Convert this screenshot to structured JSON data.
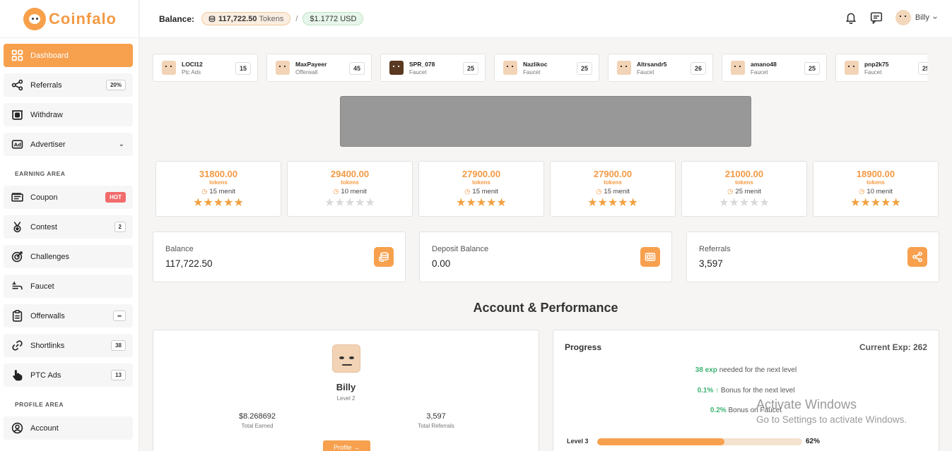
{
  "brand": {
    "name": "Coinfalo"
  },
  "topbar": {
    "balance_label": "Balance:",
    "tokens_value": "117,722.50",
    "tokens_unit": "Tokens",
    "separator": "/",
    "usd_value": "$1.1772 USD",
    "user_name": "Billy"
  },
  "sidebar": {
    "items": [
      {
        "label": "Dashboard",
        "icon": "dashboard-grid-icon",
        "active": true
      },
      {
        "label": "Referrals",
        "icon": "share-icon",
        "badge": "20%"
      },
      {
        "label": "Withdraw",
        "icon": "withdraw-icon"
      },
      {
        "label": "Advertiser",
        "icon": "ad-icon",
        "chevron": "⌄"
      }
    ],
    "earning_label": "EARNING AREA",
    "earning_items": [
      {
        "label": "Coupon",
        "icon": "ticket-icon",
        "badge": "HOT"
      },
      {
        "label": "Contest",
        "icon": "medal-icon",
        "badge": "2"
      },
      {
        "label": "Challenges",
        "icon": "target-icon"
      },
      {
        "label": "Faucet",
        "icon": "faucet-icon"
      },
      {
        "label": "Offerwalls",
        "icon": "clipboard-icon",
        "badge": "∞"
      },
      {
        "label": "Shortlinks",
        "icon": "link-icon",
        "badge": "38"
      },
      {
        "label": "PTC Ads",
        "icon": "pointer-hand-icon",
        "badge": "13"
      }
    ],
    "profile_label": "PROFILE AREA",
    "profile_items": [
      {
        "label": "Account",
        "icon": "user-circle-icon"
      }
    ]
  },
  "activity": [
    {
      "user": "LOCI12",
      "source": "Ptc Ads",
      "amount": "15"
    },
    {
      "user": "MaxPayeer",
      "source": "Offerwall",
      "amount": "45"
    },
    {
      "user": "SPR_078",
      "source": "Faucet",
      "amount": "25"
    },
    {
      "user": "Nazlikoc",
      "source": "Faucet",
      "amount": "25"
    },
    {
      "user": "Altrsandr5",
      "source": "Faucet",
      "amount": "26"
    },
    {
      "user": "amano48",
      "source": "Faucet",
      "amount": "25"
    },
    {
      "user": "pnp2k75",
      "source": "Faucet",
      "amount": "25"
    }
  ],
  "offers": [
    {
      "value": "31800.00",
      "unit": "tokens",
      "time": "15 menit",
      "rating": 5
    },
    {
      "value": "29400.00",
      "unit": "tokens",
      "time": "10 menit",
      "rating": 0
    },
    {
      "value": "27900.00",
      "unit": "tokens",
      "time": "15 menit",
      "rating": 5
    },
    {
      "value": "27900.00",
      "unit": "tokens",
      "time": "15 menit",
      "rating": 5
    },
    {
      "value": "21000.00",
      "unit": "tokens",
      "time": "25 menit",
      "rating": 0
    },
    {
      "value": "18900.00",
      "unit": "tokens",
      "time": "10 menit",
      "rating": 5
    }
  ],
  "stats": [
    {
      "label": "Balance",
      "value": "117,722.50",
      "icon": "coins-icon"
    },
    {
      "label": "Deposit Balance",
      "value": "0.00",
      "icon": "wallet-icon"
    },
    {
      "label": "Referrals",
      "value": "3,597",
      "icon": "share-icon"
    }
  ],
  "section_title": "Account & Performance",
  "profile": {
    "name": "Billy",
    "level": "Level 2",
    "total_earned": "$8.268692",
    "total_earned_label": "Total Earned",
    "total_referrals": "3,597",
    "total_referrals_label": "Total Referrals",
    "button": "Profile →"
  },
  "progress": {
    "title": "Progress",
    "current_exp": "Current Exp: 262",
    "exp_needed": "38 exp",
    "exp_needed_text": "needed for the next level",
    "bonus_next": "0.1% ↑",
    "bonus_next_text": "Bonus for the next level",
    "bonus_faucet": "0.2%",
    "bonus_faucet_text": "Bonus on Faucet",
    "level_label": "Level 3",
    "percent": 62,
    "percent_label": "62%"
  },
  "watermark": {
    "line1": "Activate Windows",
    "line2": "Go to Settings to activate Windows."
  },
  "colors": {
    "accent": "#f7a04e",
    "green": "#3cb371",
    "hot": "#f26b6b"
  }
}
